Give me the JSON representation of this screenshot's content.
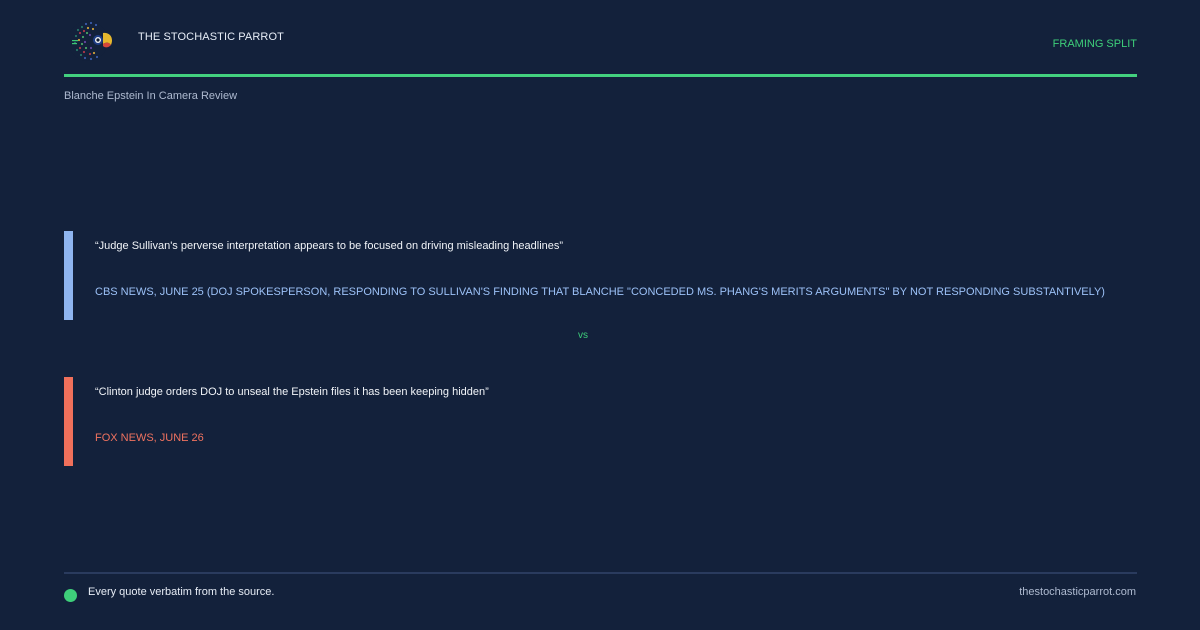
{
  "header": {
    "brand": "THE STOCHASTIC PARROT",
    "framing_label": "FRAMING SPLIT",
    "logo_icon": "parrot-logo-icon"
  },
  "topic": "Blanche Epstein In Camera Review",
  "quotes": [
    {
      "text": "“Judge Sullivan's perverse interpretation appears to be focused on driving misleading headlines”",
      "source": "CBS NEWS, JUNE 25 (DOJ SPOKESPERSON, RESPONDING TO SULLIVAN'S FINDING THAT BLANCHE \"CONCEDED MS. PHANG'S MERITS ARGUMENTS\" BY NOT RESPONDING SUBSTANTIVELY)",
      "source_icon": "",
      "accent": "#8fb5f0"
    },
    {
      "text": "“Clinton judge orders DOJ to unseal the Epstein files it has been keeping hidden”",
      "source": "FOX NEWS, JUNE 26",
      "source_icon": "",
      "accent": "#f0705b"
    }
  ],
  "vs_label": "vs",
  "footer": {
    "note": "Every quote verbatim from the source.",
    "site": "thestochasticparrot.com"
  },
  "colors": {
    "background": "#13213b",
    "accent_green": "#3ecf7a",
    "cbs_blue": "#8fb5f0",
    "fox_red": "#f0705b"
  }
}
